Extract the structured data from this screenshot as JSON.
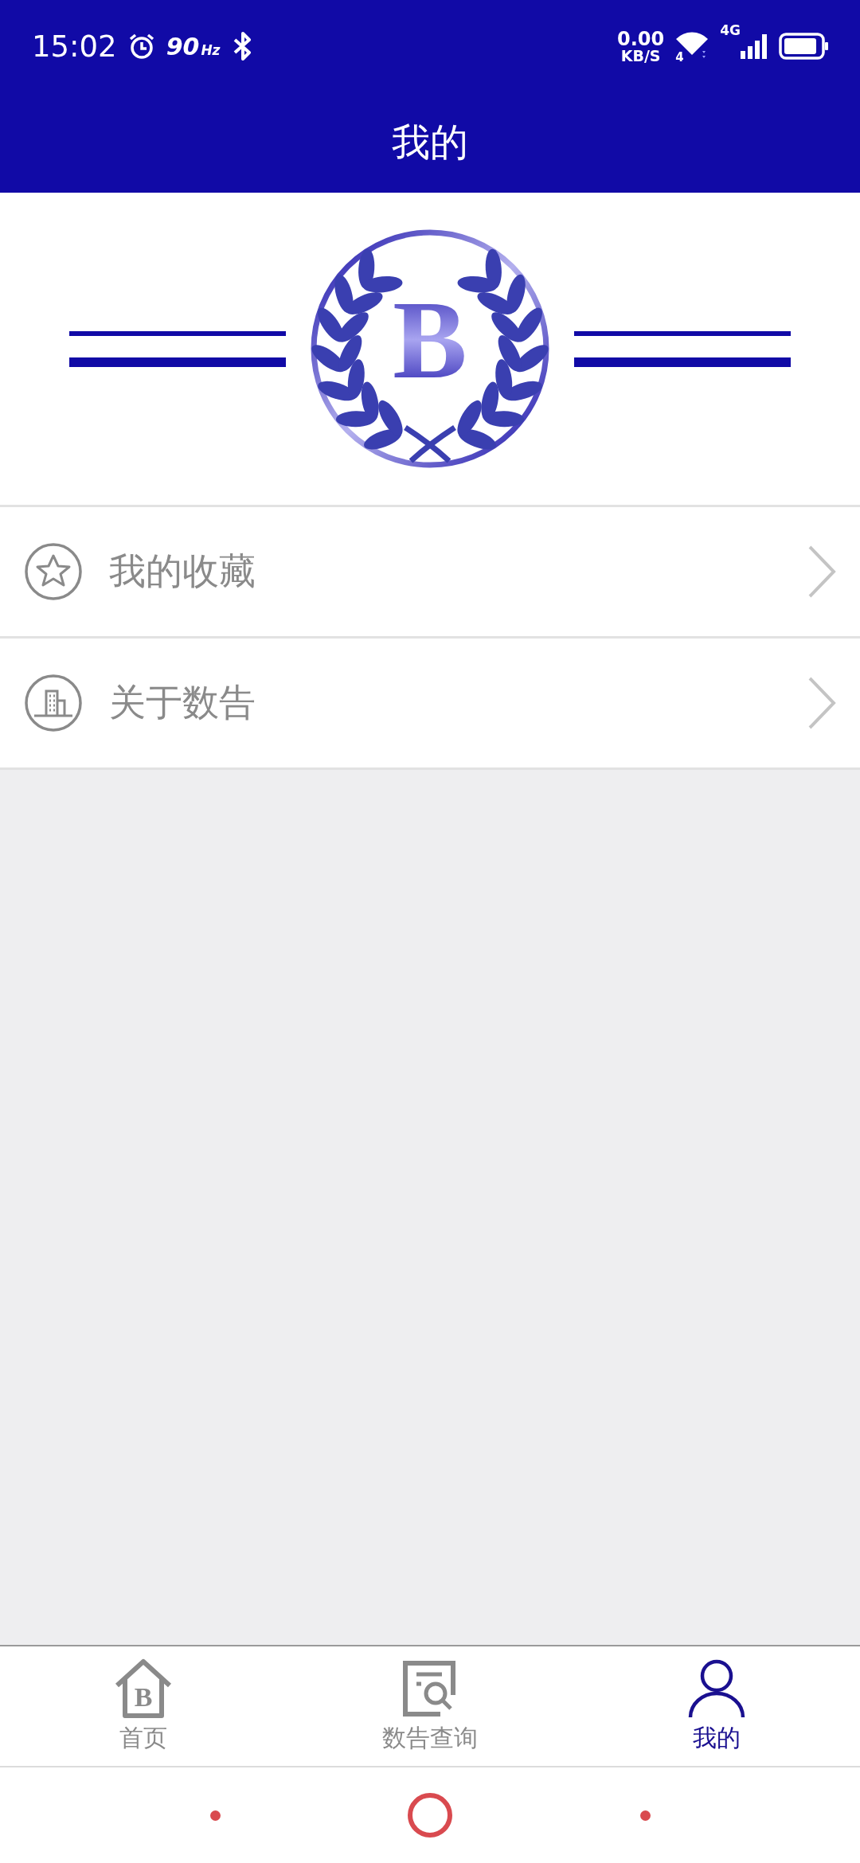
{
  "status_bar": {
    "time": "15:02",
    "refresh_rate": "90",
    "refresh_unit": "Hz",
    "net_speed": "0.00",
    "net_speed_unit": "KB/S",
    "wifi_badge": "4",
    "network_type": "4G"
  },
  "header": {
    "title": "我的"
  },
  "logo": {
    "letter": "B"
  },
  "menu": [
    {
      "label": "我的收藏",
      "kind": "star"
    },
    {
      "label": "关于数告",
      "kind": "building"
    }
  ],
  "tabs": [
    {
      "label": "首页",
      "kind": "home",
      "icon_letter": "B",
      "selected": false
    },
    {
      "label": "数告查询",
      "kind": "search",
      "selected": false
    },
    {
      "label": "我的",
      "kind": "profile",
      "selected": true
    }
  ]
}
